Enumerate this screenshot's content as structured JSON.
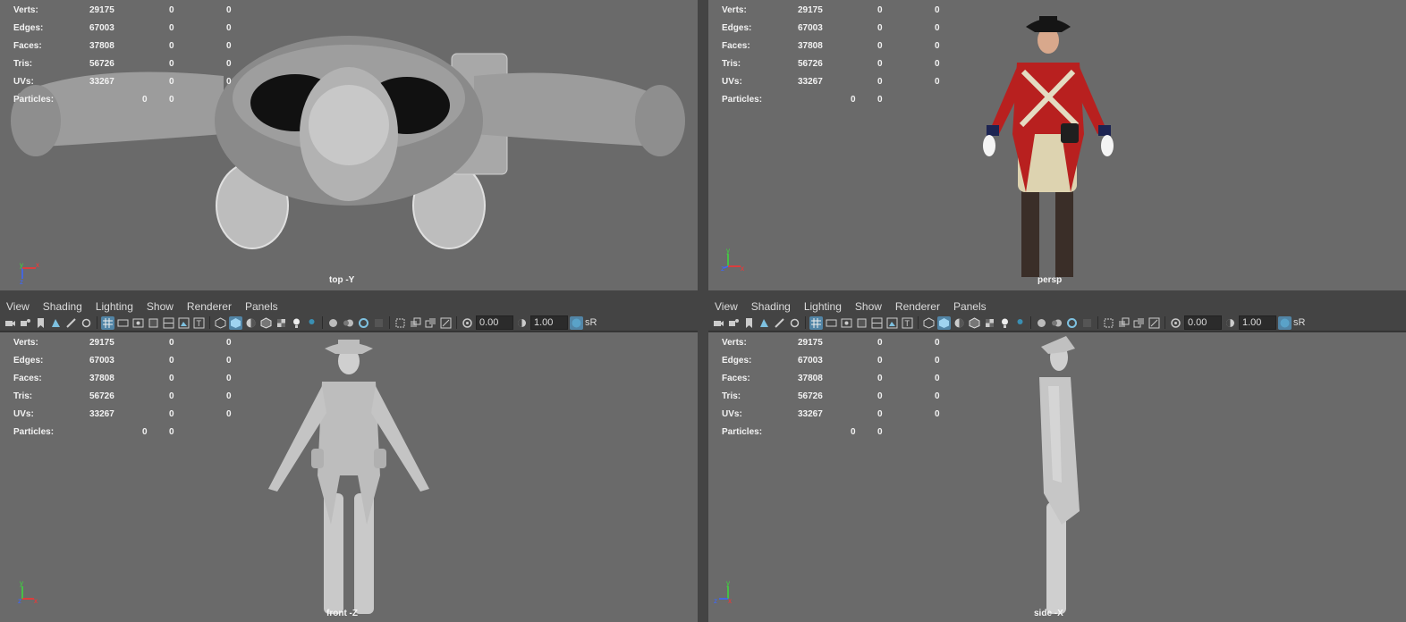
{
  "stats": {
    "labels": [
      "Verts:",
      "Edges:",
      "Faces:",
      "Tris:",
      "UVs:",
      "Particles:"
    ],
    "rows": [
      {
        "label": "Verts:",
        "v1": "29175",
        "v2": "0",
        "v3": "0"
      },
      {
        "label": "Edges:",
        "v1": "67003",
        "v2": "0",
        "v3": "0"
      },
      {
        "label": "Faces:",
        "v1": "37808",
        "v2": "0",
        "v3": "0"
      },
      {
        "label": "Tris:",
        "v1": "56726",
        "v2": "0",
        "v3": "0"
      },
      {
        "label": "UVs:",
        "v1": "33267",
        "v2": "0",
        "v3": "0"
      },
      {
        "label": "Particles:",
        "v1": "",
        "v2": "0",
        "v3": "0"
      }
    ]
  },
  "viewports": {
    "top": {
      "camera": "top -Y"
    },
    "persp": {
      "camera": "persp"
    },
    "front": {
      "camera": "front -Z"
    },
    "side": {
      "camera": "side -X"
    }
  },
  "menu": {
    "view": "View",
    "shading": "Shading",
    "lighting": "Lighting",
    "show": "Show",
    "renderer": "Renderer",
    "panels": "Panels"
  },
  "toolbar": {
    "exposure": "0.00",
    "gamma": "1.00",
    "colorspace_label": "sR"
  },
  "colors": {
    "viewport_bg": "#6a6a6a",
    "panel_bg": "#444444",
    "active_icon": "#5285a6",
    "coat_red": "#b8201f"
  }
}
